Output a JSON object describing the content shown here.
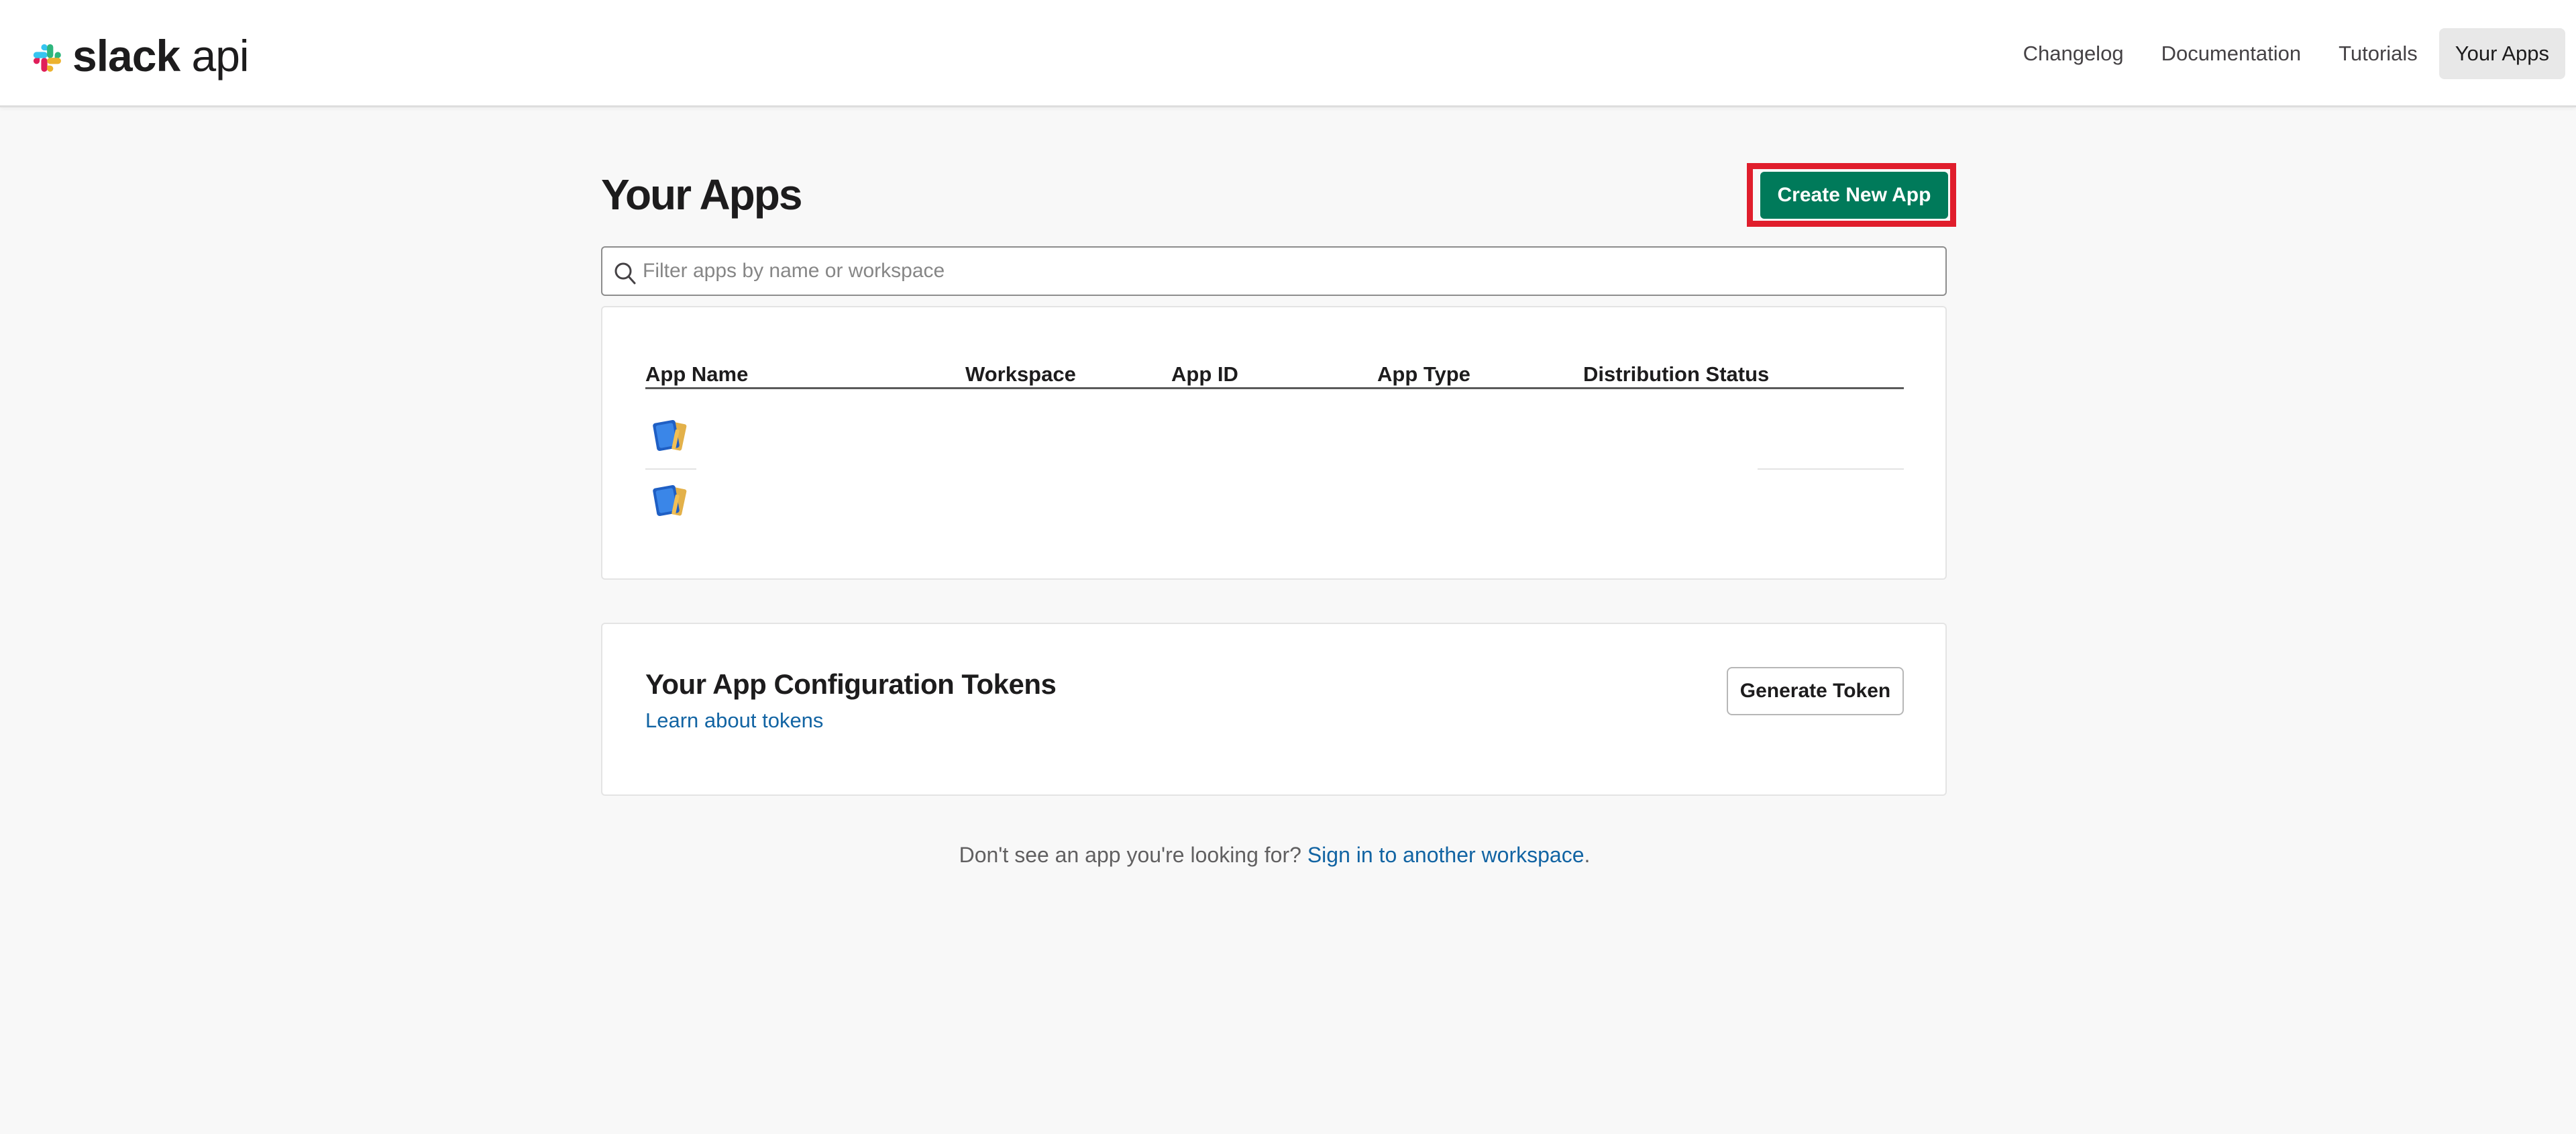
{
  "header": {
    "logo": {
      "word_bold": "slack",
      "word_light": " api",
      "icon": "slack-logo-icon"
    },
    "nav": [
      {
        "label": "Changelog",
        "active": false
      },
      {
        "label": "Documentation",
        "active": false
      },
      {
        "label": "Tutorials",
        "active": false
      },
      {
        "label": "Your Apps",
        "active": true
      }
    ]
  },
  "main": {
    "title": "Your Apps",
    "create_button_label": "Create New App",
    "highlight_color": "#e01e2c",
    "search": {
      "placeholder": "Filter apps by name or workspace",
      "value": "",
      "icon": "search-icon"
    },
    "table": {
      "columns": [
        "App Name",
        "Workspace",
        "App ID",
        "App Type",
        "Distribution Status"
      ],
      "rows": [
        {
          "icon": "app-book-icon"
        },
        {
          "icon": "app-book-icon"
        }
      ]
    }
  },
  "tokens": {
    "title": "Your App Configuration Tokens",
    "link_label": "Learn about tokens",
    "button_label": "Generate Token"
  },
  "footer": {
    "prefix": "Don't see an app you're looking for? ",
    "link_label": "Sign in to another workspace",
    "suffix": "."
  },
  "colors": {
    "accent_green": "#007a5a",
    "link_blue": "#1264a3",
    "background": "#f8f8f8"
  }
}
